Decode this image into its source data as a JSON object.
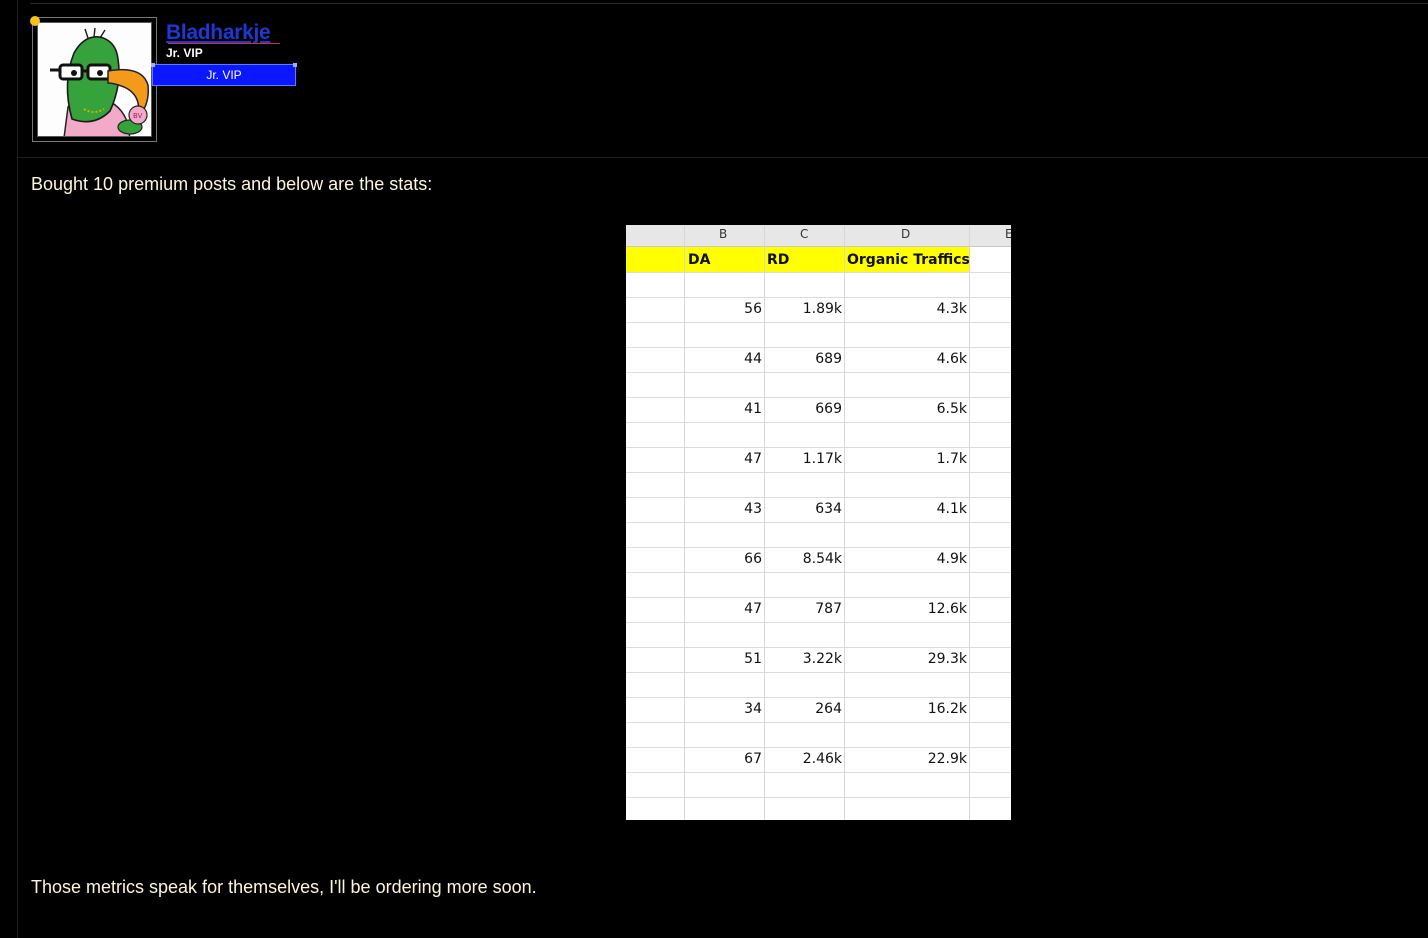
{
  "user": {
    "username": "Bladharkje",
    "title": "Jr. VIP",
    "badge": "Jr. VIP"
  },
  "post": {
    "intro": "Bought 10 premium posts and below are the stats:",
    "outro": "Those metrics speak for themselves, I'll be ordering more soon."
  },
  "sheet": {
    "columns": [
      "B",
      "C",
      "D",
      "E"
    ],
    "headers": [
      "DA",
      "RD",
      "Organic Traffics"
    ],
    "rows": [
      {
        "da": "56",
        "rd": "1.89k",
        "traffic": "4.3k"
      },
      {
        "da": "44",
        "rd": "689",
        "traffic": "4.6k"
      },
      {
        "da": "41",
        "rd": "669",
        "traffic": "6.5k"
      },
      {
        "da": "47",
        "rd": "1.17k",
        "traffic": "1.7k"
      },
      {
        "da": "43",
        "rd": "634",
        "traffic": "4.1k"
      },
      {
        "da": "66",
        "rd": "8.54k",
        "traffic": "4.9k"
      },
      {
        "da": "47",
        "rd": "787",
        "traffic": "12.6k"
      },
      {
        "da": "51",
        "rd": "3.22k",
        "traffic": "29.3k"
      },
      {
        "da": "34",
        "rd": "264",
        "traffic": "16.2k"
      },
      {
        "da": "67",
        "rd": "2.46k",
        "traffic": "22.9k"
      }
    ]
  },
  "colors": {
    "background": "#000000",
    "username": "#1c39d6",
    "badge": "#0a17ff",
    "post_text": "#fff6d8",
    "online": "#f7c21a",
    "highlight": "#ffff00"
  },
  "icons": {
    "avatar": "parrot-with-glasses-avatar",
    "online": "online-status-dot"
  }
}
